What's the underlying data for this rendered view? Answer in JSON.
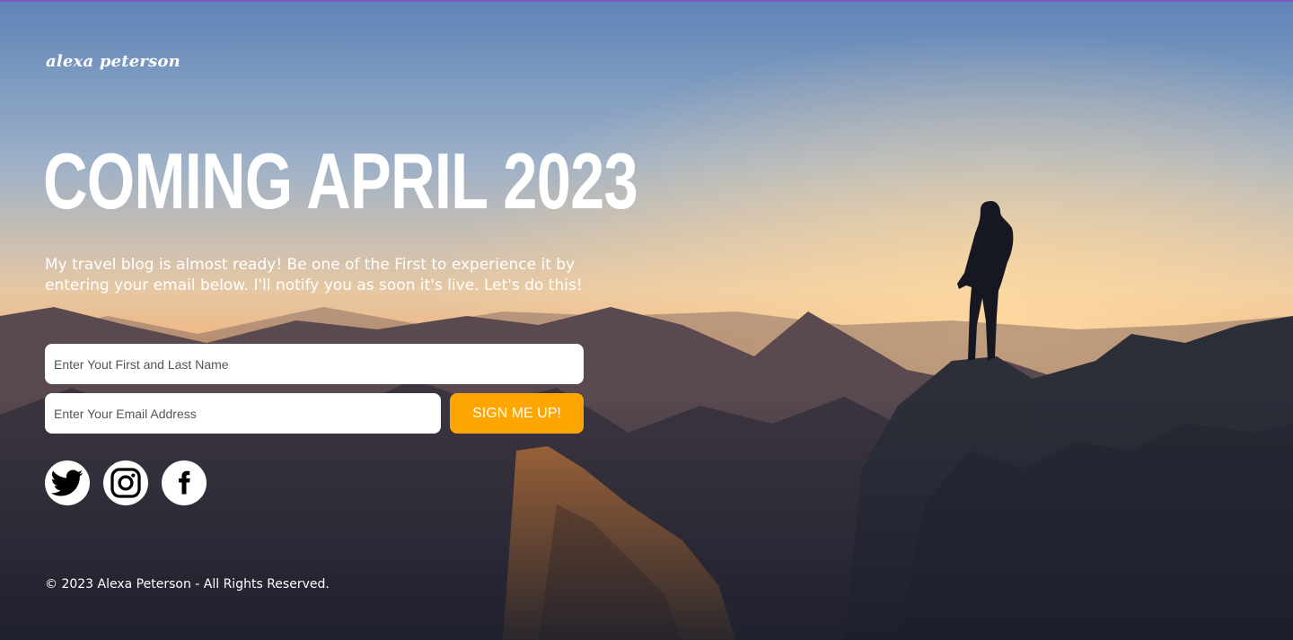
{
  "brand": {
    "name": "alexa peterson"
  },
  "hero": {
    "headline": "COMING APRIL 2023",
    "intro": "My travel blog is almost ready! Be one of the First to experience it by entering your email below. I'll notify you as soon it's live. Let's do this!"
  },
  "form": {
    "name_placeholder": "Enter Yout First and Last Name",
    "email_placeholder": "Enter Your Email Address",
    "submit_label": "SIGN ME UP!"
  },
  "social": [
    {
      "icon": "twitter-icon"
    },
    {
      "icon": "instagram-icon"
    },
    {
      "icon": "facebook-icon"
    }
  ],
  "footer": {
    "copyright": "© 2023 Alexa Peterson - All Rights Reserved."
  },
  "colors": {
    "accent": "#ffa500",
    "text": "#ffffff",
    "top_border": "#7d55c7"
  }
}
